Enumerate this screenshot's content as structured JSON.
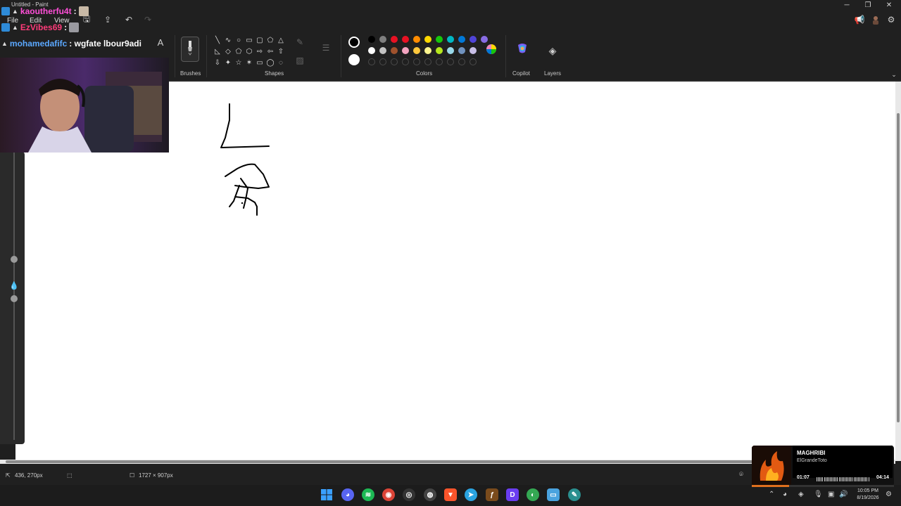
{
  "window": {
    "title": "Untitled - Paint"
  },
  "menu": {
    "file": "File",
    "edit": "Edit",
    "view": "View"
  },
  "ribbon": {
    "brushes_label": "Brushes",
    "shapes_label": "Shapes",
    "colors_label": "Colors",
    "copilot_label": "Copilot",
    "layers_label": "Layers",
    "text_tool_glyph": "A",
    "palette_row1": [
      "#000000",
      "#7f7f7f",
      "#e81123",
      "#e81123",
      "#ff8c00",
      "#ffd800",
      "#16c60c",
      "#00b7c3",
      "#0078d7",
      "#4f44d8",
      "#886ce4"
    ],
    "palette_row2": [
      "#ffffff",
      "#c3c3c3",
      "#a0522d",
      "#f4a4c0",
      "#ffc83d",
      "#fff68f",
      "#b5e61d",
      "#99d9ea",
      "#7092be",
      "#c8bfe7"
    ],
    "primary_color": "#000000",
    "secondary_color": "#ffffff"
  },
  "status": {
    "cursor_pos": "436, 270px",
    "canvas_size": "1727 × 907px"
  },
  "chat": {
    "lines": [
      {
        "user": "kaoutherfu4t",
        "message": ":",
        "color": "#ff4fd8"
      },
      {
        "user": "EzVibes69",
        "message": ":",
        "color": "#ff3b7a"
      },
      {
        "user": "mohamedafifc",
        "message": ": wgfate lbour9adi",
        "color": "#5ba8ff"
      }
    ]
  },
  "music": {
    "song": "MAGHRIBI",
    "artist": "ElGrandeToto",
    "elapsed": "01:07",
    "duration": "04:14",
    "progress": 0.26
  },
  "clock": {
    "time": "10:05 PM",
    "date": "8/19/2026"
  },
  "icons": {
    "undo": "undo-icon",
    "redo": "redo-icon",
    "share": "share-icon",
    "save": "save-icon",
    "layers": "layers-icon",
    "copilot": "copilot-icon"
  }
}
